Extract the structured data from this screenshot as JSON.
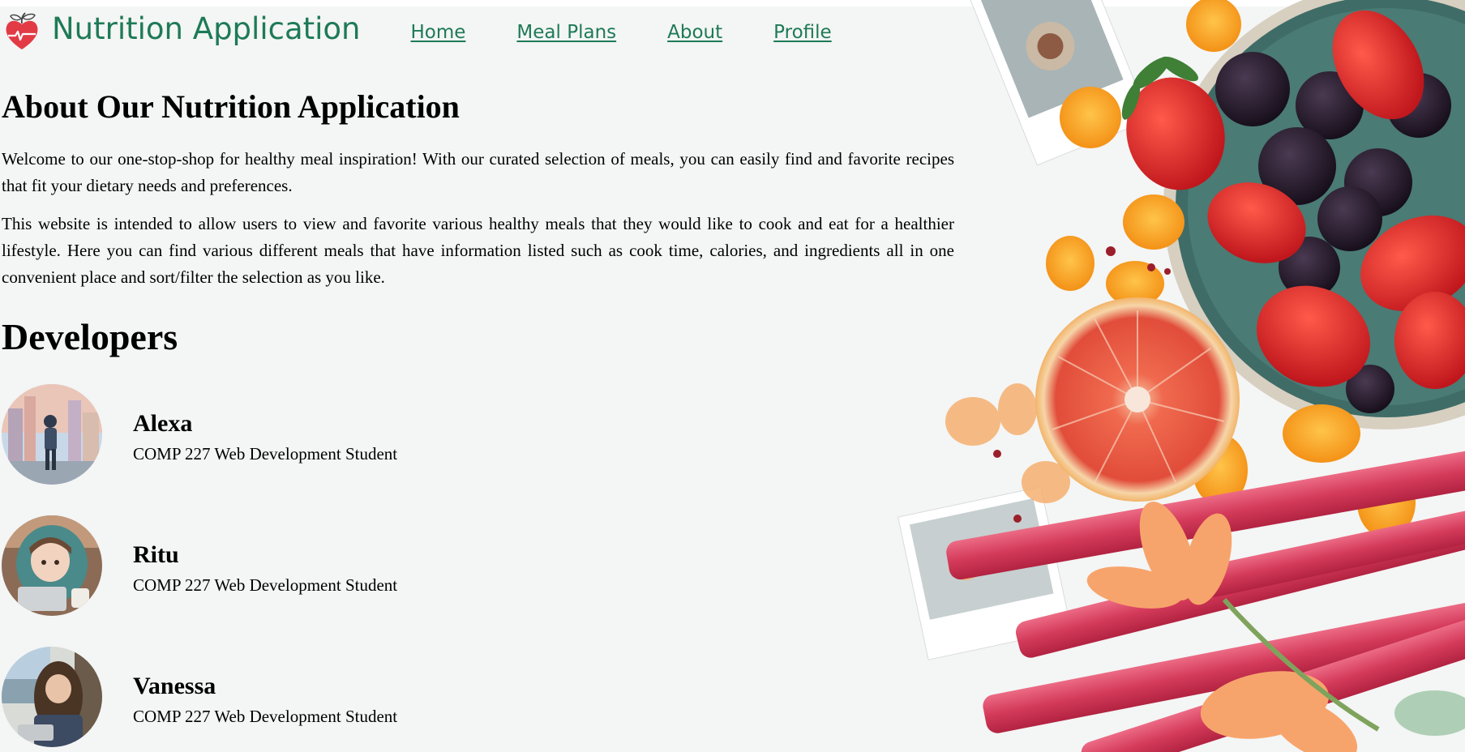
{
  "header": {
    "brand": "Nutrition Application",
    "logo_icon": "heart-apple-logo-icon",
    "nav": [
      {
        "label": "Home"
      },
      {
        "label": "Meal Plans"
      },
      {
        "label": "About"
      },
      {
        "label": "Profile"
      }
    ]
  },
  "about": {
    "title": "About Our Nutrition Application",
    "paragraphs": [
      "Welcome to our one-stop-shop for healthy meal inspiration! With our curated selection of meals, you can easily find and favorite recipes that fit your dietary needs and preferences.",
      "This website is intended to allow users to view and favorite various healthy meals that they would like to cook and eat for a healthier lifestyle. Here you can find various different meals that have information listed such as cook time, calories, and ingredients all in one convenient place and sort/filter the selection as you like."
    ]
  },
  "developers": {
    "title": "Developers",
    "list": [
      {
        "name": "Alexa",
        "role": "COMP 227 Web Development Student"
      },
      {
        "name": "Ritu",
        "role": "COMP 227 Web Development Student"
      },
      {
        "name": "Vanessa",
        "role": "COMP 227 Web Development Student"
      }
    ]
  },
  "colors": {
    "brand_green": "#1e7a57",
    "logo_red": "#e23b46",
    "background": "#f4f5f5"
  }
}
